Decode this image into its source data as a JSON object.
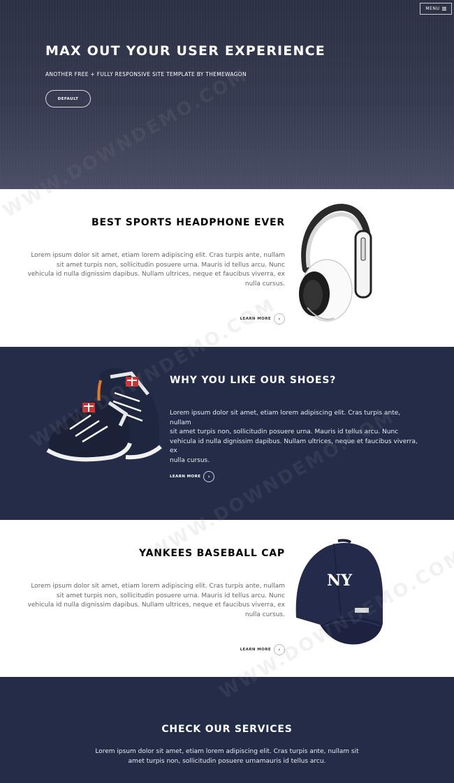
{
  "nav": {
    "menu_label": "MENU"
  },
  "hero": {
    "title": "MAX OUT YOUR USER EXPERIENCE",
    "subtitle": "ANOTHER FREE + FULLY RESPONSIVE SITE TEMPLATE BY THEMEWAGON",
    "button_label": "DEFAULT"
  },
  "sections": [
    {
      "title": "BEST SPORTS HEADPHONE EVER",
      "lines": [
        "Lorem ipsum dolor sit amet, etiam lorem adipiscing elit. Cras turpis ante, nullam",
        "sit amet turpis non, sollicitudin posuere urna. Mauris id tellus arcu. Nunc",
        "vehicula id nulla dignissim dapibus. Nullam ultrices, neque et faucibus viverra, ex",
        "nulla cursus."
      ],
      "link_label": "LEARN MORE"
    },
    {
      "title": "WHY YOU LIKE OUR SHOES?",
      "lines": [
        "Lorem ipsum dolor sit amet, etiam lorem adipiscing elit. Cras turpis ante, nullam",
        "sit amet turpis non, sollicitudin posuere urna. Mauris id tellus arcu. Nunc",
        "vehicula id nulla dignissim dapibus. Nullam ultrices, neque et faucibus viverra, ex",
        "nulla cursus."
      ],
      "link_label": "LEARN MORE"
    },
    {
      "title": "YANKEES BASEBALL CAP",
      "lines": [
        "Lorem ipsum dolor sit amet, etiam lorem adipiscing elit. Cras turpis ante, nullam",
        "sit amet turpis non, sollicitudin posuere urna. Mauris id tellus arcu. Nunc",
        "vehicula id nulla dignissim dapibus. Nullam ultrices, neque et faucibus viverra, ex",
        "nulla cursus."
      ],
      "link_label": "LEARN MORE"
    }
  ],
  "services": {
    "title": "CHECK OUR SERVICES",
    "lines": [
      "Lorem ipsum dolor sit amet, etiam lorem adipiscing elit. Cras turpis ante, nullam sit",
      "amet turpis non, sollicitudin posuere urnamauris id tellus arcu."
    ]
  },
  "watermark": "WWW.DOWNDEMO.COM",
  "icons": {
    "menu": "hamburger-icon",
    "arrow": "chevron-right-icon"
  },
  "colors": {
    "hero_top": "#2c3145",
    "navy": "#252c48",
    "white": "#ffffff",
    "body_text": "#666666"
  }
}
